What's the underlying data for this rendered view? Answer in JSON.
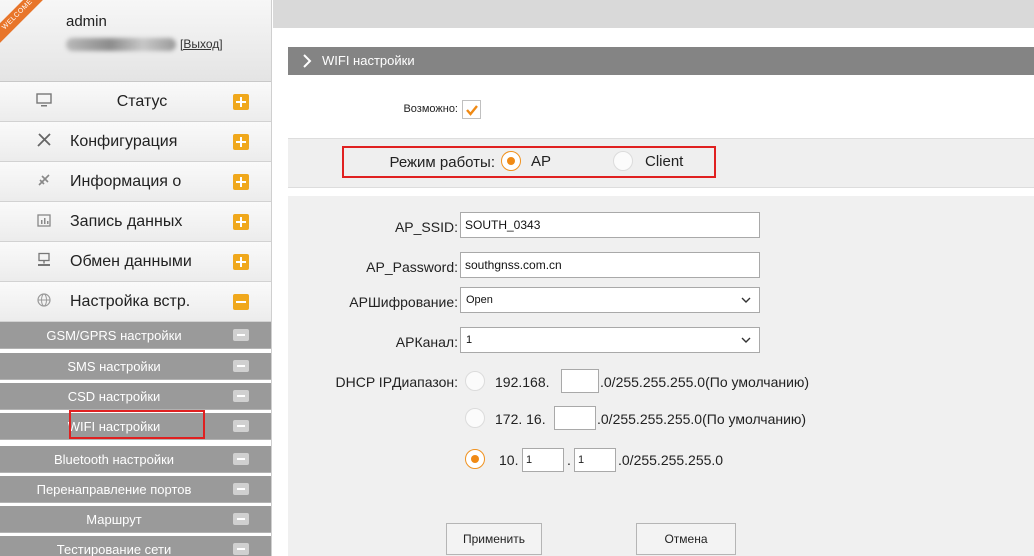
{
  "user": {
    "badge": "WELCOME",
    "name": "admin",
    "logout": "[Выход]"
  },
  "menu": [
    {
      "label": "Статус",
      "icon": "monitor-icon",
      "expanded": false
    },
    {
      "label": "Конфигурация",
      "icon": "tools-icon",
      "expanded": false
    },
    {
      "label": "Информация о",
      "icon": "satellite-icon",
      "expanded": false
    },
    {
      "label": "Запись данных",
      "icon": "calendar-icon",
      "expanded": false
    },
    {
      "label": "Обмен данными",
      "icon": "network-icon",
      "expanded": false
    },
    {
      "label": "Настройка встр.",
      "icon": "globe-icon",
      "expanded": true
    }
  ],
  "submenu": [
    {
      "label": "GSM/GPRS настройки"
    },
    {
      "label": "SMS настройки"
    },
    {
      "label": "CSD настройки"
    },
    {
      "label": "WIFI настройки",
      "active": true
    },
    {
      "label": "Bluetooth настройки"
    },
    {
      "label": "Перенаправление портов"
    },
    {
      "label": "Маршрут"
    },
    {
      "label": "Тестирование сети"
    }
  ],
  "page": {
    "title": "WIFI настройки"
  },
  "form": {
    "enable_label": "Возможно:",
    "enable_checked": true,
    "mode_label": "Режим работы:",
    "mode_options": [
      "AP",
      "Client"
    ],
    "mode_selected": "AP",
    "ssid_label": "AP_SSID:",
    "ssid_value": "SOUTH_0343",
    "password_label": "AP_Password:",
    "password_value": "southgnss.com.cn",
    "encryption_label": "APШифрование:",
    "encryption_value": "Open",
    "channel_label": "APКанал:",
    "channel_value": "1",
    "dhcp_label": "DHCP IPДиапазон:",
    "dhcp_options": [
      {
        "prefix": "192.168.",
        "suffix": ".0/255.255.255.0(По умолчанию)",
        "values": [
          ""
        ],
        "selected": false
      },
      {
        "prefix": "172. 16.",
        "suffix": ".0/255.255.255.0(По умолчанию)",
        "values": [
          ""
        ],
        "selected": false
      },
      {
        "prefix": "10.",
        "suffix": ".0/255.255.255.0",
        "values": [
          "1",
          "1"
        ],
        "selected": true
      }
    ],
    "apply_label": "Применить",
    "cancel_label": "Отмена"
  },
  "colors": {
    "accent": "#f0a81c",
    "highlight": "#e02020",
    "title_bar": "#848484",
    "submenu_bg": "#9a9a9a"
  }
}
